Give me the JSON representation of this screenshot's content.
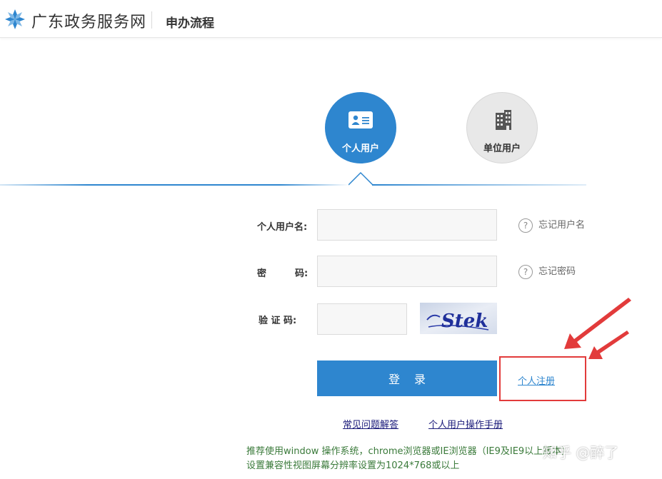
{
  "header": {
    "site_name": "广东政务服务网",
    "section": "申办流程"
  },
  "user_types": {
    "personal": "个人用户",
    "unit": "单位用户"
  },
  "form": {
    "username_label": "个人用户名:",
    "password_label_1": "密",
    "password_label_2": "码:",
    "captcha_label": "验 证 码:",
    "username_value": "",
    "password_value": "",
    "captcha_value": "",
    "captcha_text": "Stek",
    "forgot_username": "忘记用户名",
    "forgot_password": "忘记密码",
    "login_button": "登录",
    "register_link": "个人注册"
  },
  "links": {
    "faq": "常见问题解答",
    "manual": "个人用户操作手册"
  },
  "tips": {
    "line1": "推荐使用window 操作系统，chrome浏览器或IE浏览器（IE9及IE9以上版本）",
    "line2": "设置兼容性视图屏幕分辨率设置为1024*768或以上"
  },
  "watermark": "知乎 @醉了",
  "colors": {
    "accent": "#2e86cf",
    "highlight": "#e23b3b",
    "tip": "#3a7a3a"
  }
}
